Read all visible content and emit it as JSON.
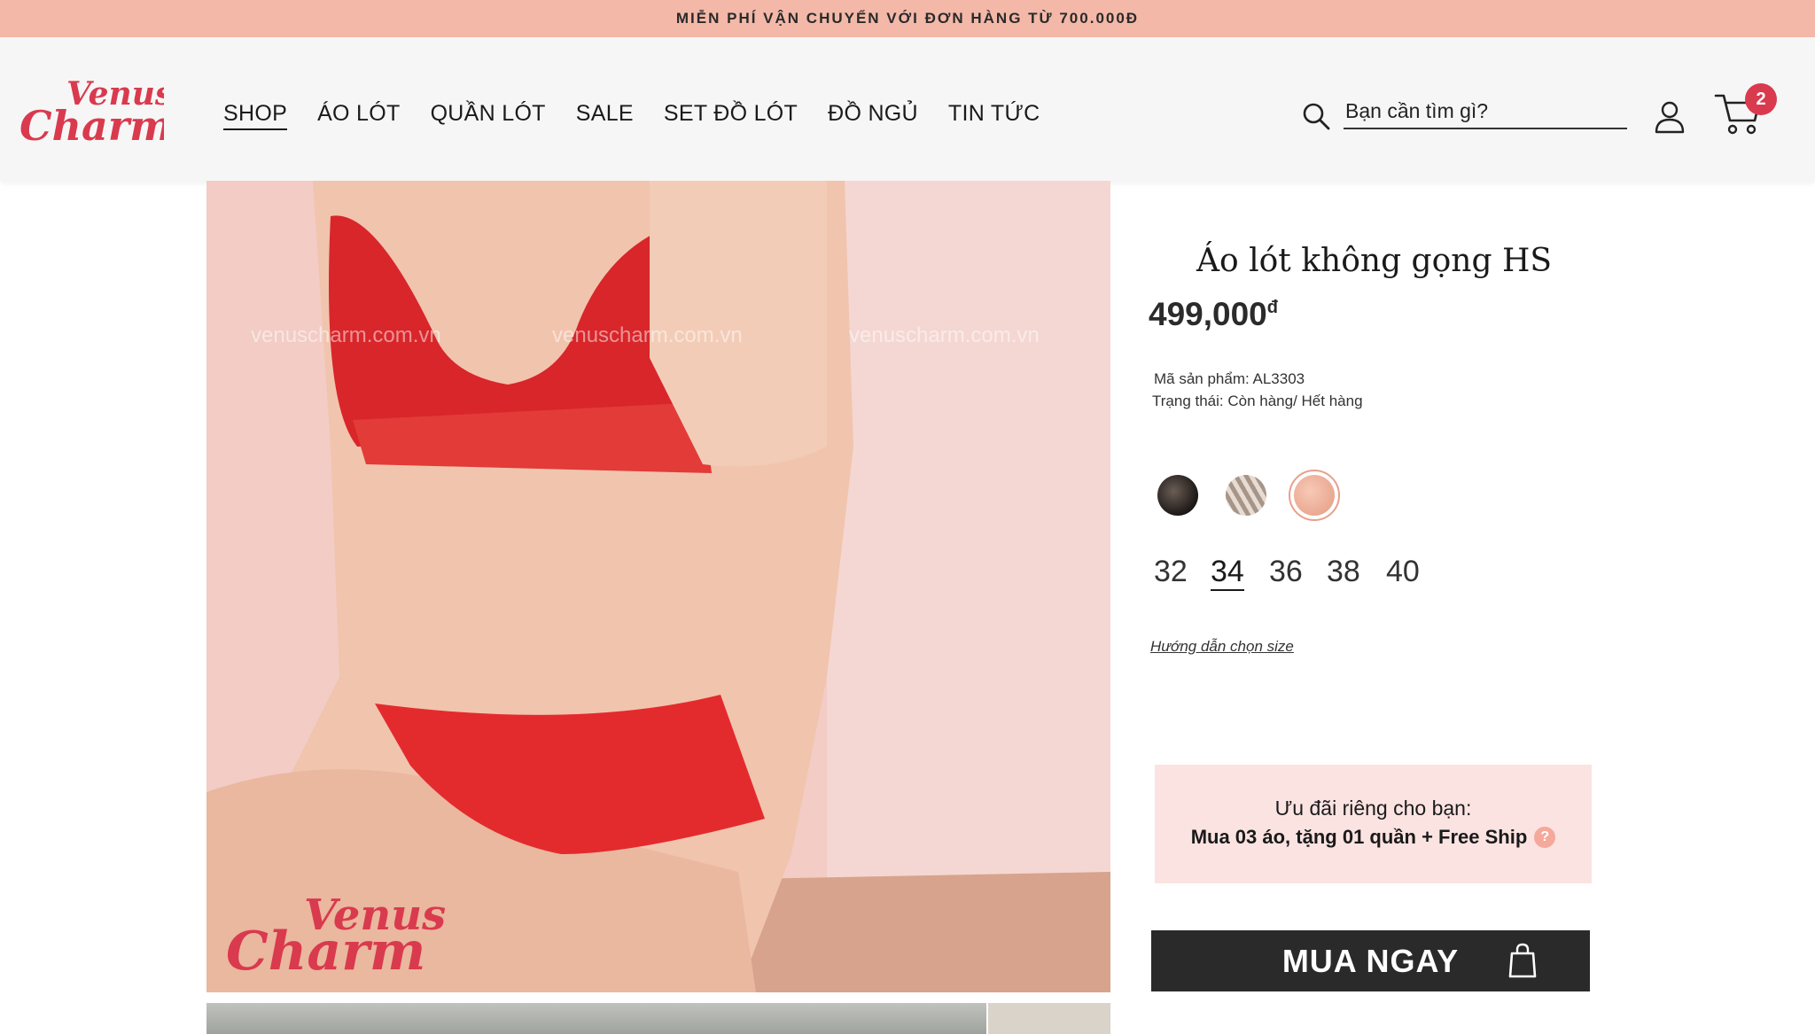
{
  "promo": {
    "text": "MIỄN PHÍ VẬN CHUYỂN VỚI ĐƠN HÀNG TỪ 700.000Đ"
  },
  "header": {
    "logo_text_line1": "Venus",
    "logo_text_line2": "Charm",
    "nav": [
      "SHOP",
      "ÁO LÓT",
      "QUẦN LÓT",
      "SALE",
      "SET ĐỒ LÓT",
      "ĐỒ NGỦ",
      "TIN TỨC"
    ],
    "active_nav": "SHOP",
    "search": {
      "placeholder": "Bạn cần tìm gì?",
      "icon": "search-icon"
    },
    "user_icon": "user-icon",
    "cart": {
      "icon": "cart-icon",
      "count": "2"
    }
  },
  "gallery": {
    "watermarks": [
      "venuscharm.com.vn",
      "venuscharm.com.vn",
      "venuscharm.com.vn"
    ],
    "image_logo_line1": "Venus",
    "image_logo_line2": "Charm"
  },
  "product": {
    "title": "Áo lót không gọng HS",
    "price": "499,000",
    "currency": "đ",
    "sku_line": "Mã sản phẩm: AL3303",
    "status_line": "Trạng thái: Còn hàng/ Hết hàng",
    "colors": [
      {
        "name": "black",
        "hex": "#2a2624"
      },
      {
        "name": "beige-stripe",
        "hex": "#cbbcb0"
      },
      {
        "name": "nude-pink",
        "hex": "#f0b59f",
        "selected": true
      }
    ],
    "sizes": [
      "32",
      "34",
      "36",
      "38",
      "40"
    ],
    "selected_size": "34",
    "size_guide": "Hướng dẫn chọn size"
  },
  "offer": {
    "title": "Ưu đãi riêng cho bạn:",
    "detail": "Mua 03 áo, tặng 01 quần + Free Ship",
    "help": "?"
  },
  "buy": {
    "label": "MUA NGAY",
    "icon": "shopping-bag-icon"
  },
  "colors": {
    "promo_bg": "#f4b8a8",
    "brand_red": "#d93a4e",
    "buy_bg": "#2a2a2a",
    "offer_bg": "#fbe3e2"
  }
}
